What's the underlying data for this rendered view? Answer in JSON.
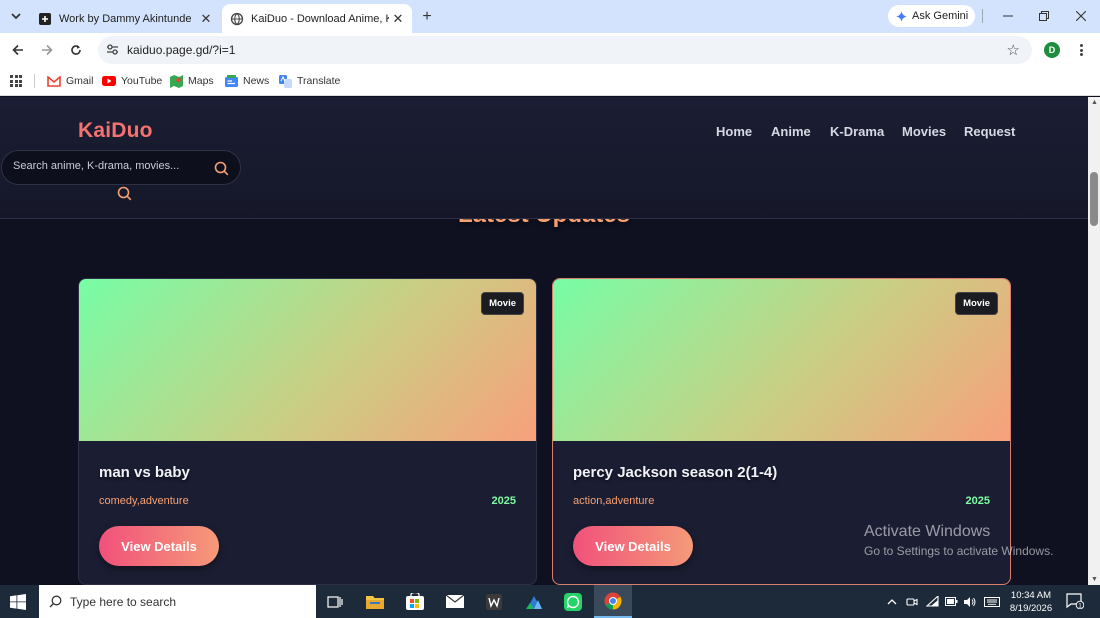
{
  "browser": {
    "tabs": [
      {
        "title": "Work by Dammy Akintunde",
        "active": false
      },
      {
        "title": "KaiDuo - Download Anime, K-Drama",
        "active": true
      }
    ],
    "gemini_label": "Ask Gemini",
    "url": "kaiduo.page.gd/?i=1",
    "profile_initial": "D",
    "bookmarks": [
      "Gmail",
      "YouTube",
      "Maps",
      "News",
      "Translate"
    ]
  },
  "site": {
    "logo": "KaiDuo",
    "nav": [
      "Home",
      "Anime",
      "K-Drama",
      "Movies",
      "Request"
    ],
    "search_placeholder": "Search anime, K-drama, movies...",
    "section_title": "Latest Updates",
    "cards": [
      {
        "badge": "Movie",
        "title": "man vs baby",
        "genres": "comedy,adventure",
        "year": "2025",
        "button": "View Details"
      },
      {
        "badge": "Movie",
        "title": "percy Jackson season 2(1-4)",
        "genres": "action,adventure",
        "year": "2025",
        "button": "View Details"
      }
    ],
    "colors": {
      "accent": "#f4736f",
      "year": "#7dfca0",
      "genre": "#f7a172"
    }
  },
  "watermark": {
    "line1": "Activate Windows",
    "line2": "Go to Settings to activate Windows."
  },
  "taskbar": {
    "search_placeholder": "Type here to search",
    "apps": [
      "task-view-icon",
      "file-explorer-icon",
      "store-icon",
      "mail-icon",
      "word-icon",
      "app-icon",
      "whatsapp-icon",
      "chrome-icon"
    ],
    "time": "10:34 AM",
    "date": "8/19/2026",
    "notification_count": "1"
  }
}
